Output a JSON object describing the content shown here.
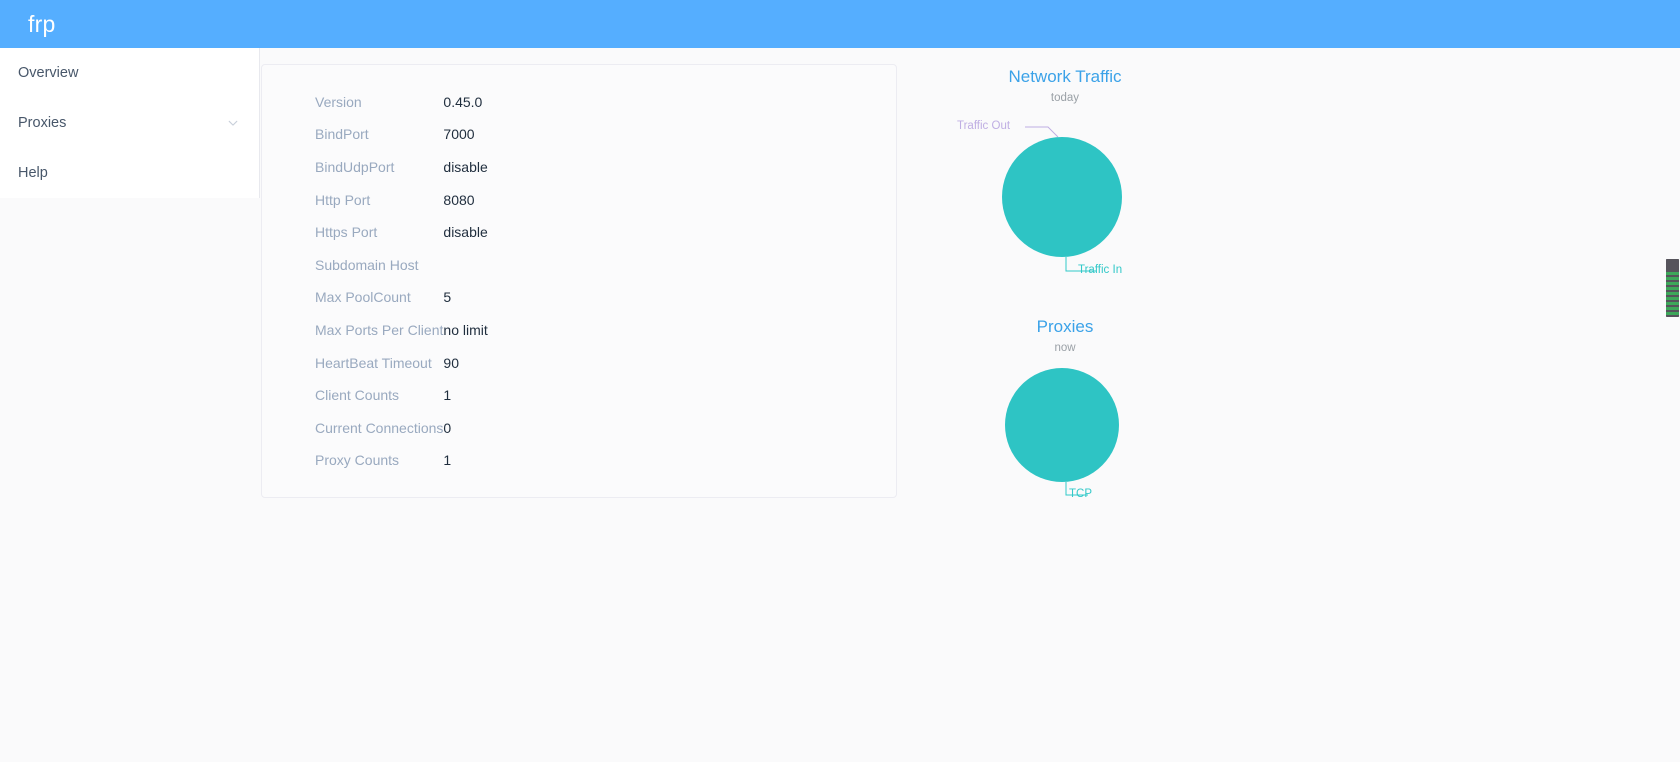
{
  "header": {
    "brand": "frp"
  },
  "sidebar": {
    "items": [
      {
        "label": "Overview",
        "icon": "",
        "expandable": false
      },
      {
        "label": "Proxies",
        "icon": "chevron-down-icon",
        "expandable": true
      },
      {
        "label": "Help",
        "icon": "",
        "expandable": false
      }
    ]
  },
  "server_info": {
    "rows": [
      {
        "key": "Version",
        "value": "0.45.0"
      },
      {
        "key": "BindPort",
        "value": "7000"
      },
      {
        "key": "BindUdpPort",
        "value": "disable"
      },
      {
        "key": "Http Port",
        "value": "8080"
      },
      {
        "key": "Https Port",
        "value": "disable"
      },
      {
        "key": "Subdomain Host",
        "value": ""
      },
      {
        "key": "Max PoolCount",
        "value": "5"
      },
      {
        "key": "Max Ports Per Client",
        "value": "no limit"
      },
      {
        "key": "HeartBeat Timeout",
        "value": "90"
      },
      {
        "key": "Client Counts",
        "value": "1"
      },
      {
        "key": "Current Connections",
        "value": "0"
      },
      {
        "key": "Proxy Counts",
        "value": "1"
      }
    ]
  },
  "chart_data": [
    {
      "type": "pie",
      "title": "Network Traffic",
      "subtitle": "today",
      "labels": [
        "Traffic Out",
        "Traffic In"
      ],
      "values": [
        0,
        100
      ],
      "colors": [
        "#BFAEE3",
        "#2EC4C4"
      ],
      "label_colors": [
        "#BFAEE3",
        "#33C9C9"
      ],
      "legend": "labels-with-leader-lines",
      "note": "Single visible teal slice occupying the full circle; Traffic Out slice is zero-width at top"
    },
    {
      "type": "pie",
      "title": "Proxies",
      "subtitle": "now",
      "labels": [
        "TCP"
      ],
      "values": [
        1
      ],
      "colors": [
        "#2EC4C4"
      ],
      "label_colors": [
        "#33C9C9"
      ],
      "legend": "labels-with-leader-lines"
    }
  ],
  "scrollbar": {
    "orientation": "vertical",
    "position_percent": 30
  },
  "colors": {
    "header_blue": "#55AEFF",
    "accent_blue": "#3BA2E8",
    "teal": "#2EC4C4",
    "lavender": "#BFAEE3",
    "key_text": "#99A9BF",
    "value_text": "#1F2D3D",
    "page_bg": "#FAFAFB",
    "card_bg": "#FBFBFC",
    "card_border": "#ECECF2"
  }
}
